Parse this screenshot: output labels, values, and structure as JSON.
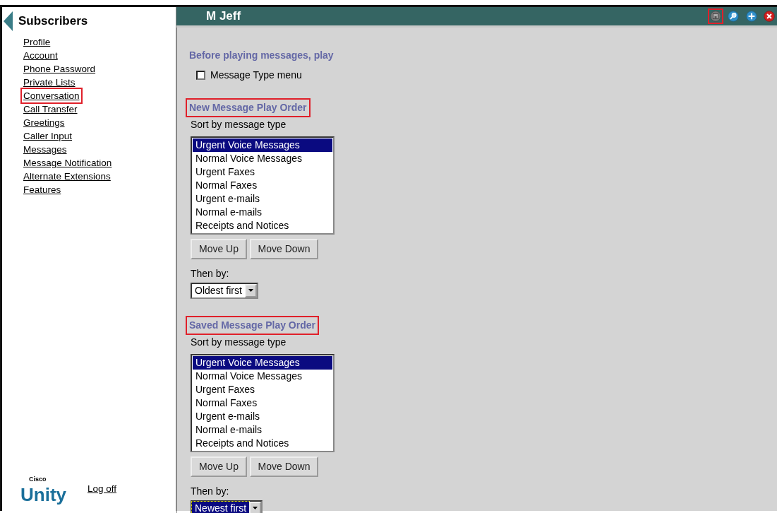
{
  "sidebar": {
    "title": "Subscribers",
    "items": [
      {
        "label": "Profile",
        "highlighted": false
      },
      {
        "label": "Account",
        "highlighted": false
      },
      {
        "label": "Phone Password",
        "highlighted": false
      },
      {
        "label": "Private Lists",
        "highlighted": false
      },
      {
        "label": "Conversation",
        "highlighted": true
      },
      {
        "label": "Call Transfer",
        "highlighted": false
      },
      {
        "label": "Greetings",
        "highlighted": false
      },
      {
        "label": "Caller Input",
        "highlighted": false
      },
      {
        "label": "Messages",
        "highlighted": false
      },
      {
        "label": "Message Notification",
        "highlighted": false
      },
      {
        "label": "Alternate Extensions",
        "highlighted": false
      },
      {
        "label": "Features",
        "highlighted": false
      }
    ],
    "logo": {
      "small": "Cisco",
      "big": "Unity"
    },
    "logoff": "Log off"
  },
  "header": {
    "title": "M Jeff",
    "tools": [
      {
        "kind": "save",
        "highlighted": true
      },
      {
        "kind": "search",
        "highlighted": false
      },
      {
        "kind": "add",
        "highlighted": false
      },
      {
        "kind": "delete",
        "highlighted": false
      }
    ]
  },
  "intro": {
    "heading": "Before playing messages, play",
    "checkbox": {
      "label": "Message Type menu",
      "checked": false
    }
  },
  "sections": [
    {
      "title": "New Message Play Order",
      "highlighted": true,
      "sort_label": "Sort by message type",
      "items": [
        {
          "label": "Urgent Voice Messages",
          "selected": true
        },
        {
          "label": "Normal Voice Messages",
          "selected": false
        },
        {
          "label": "Urgent Faxes",
          "selected": false
        },
        {
          "label": "Normal Faxes",
          "selected": false
        },
        {
          "label": "Urgent e-mails",
          "selected": false
        },
        {
          "label": "Normal e-mails",
          "selected": false
        },
        {
          "label": "Receipts and Notices",
          "selected": false
        }
      ],
      "buttons": [
        "Move Up",
        "Move Down"
      ],
      "then_label": "Then by:",
      "then_value": "Oldest first",
      "focused": false
    },
    {
      "title": "Saved Message Play Order",
      "highlighted": true,
      "sort_label": "Sort by message type",
      "items": [
        {
          "label": "Urgent Voice Messages",
          "selected": true
        },
        {
          "label": "Normal Voice Messages",
          "selected": false
        },
        {
          "label": "Urgent Faxes",
          "selected": false
        },
        {
          "label": "Normal Faxes",
          "selected": false
        },
        {
          "label": "Urgent e-mails",
          "selected": false
        },
        {
          "label": "Normal e-mails",
          "selected": false
        },
        {
          "label": "Receipts and Notices",
          "selected": false
        }
      ],
      "buttons": [
        "Move Up",
        "Move Down"
      ],
      "then_label": "Then by:",
      "then_value": "Newest first",
      "focused": true
    }
  ]
}
